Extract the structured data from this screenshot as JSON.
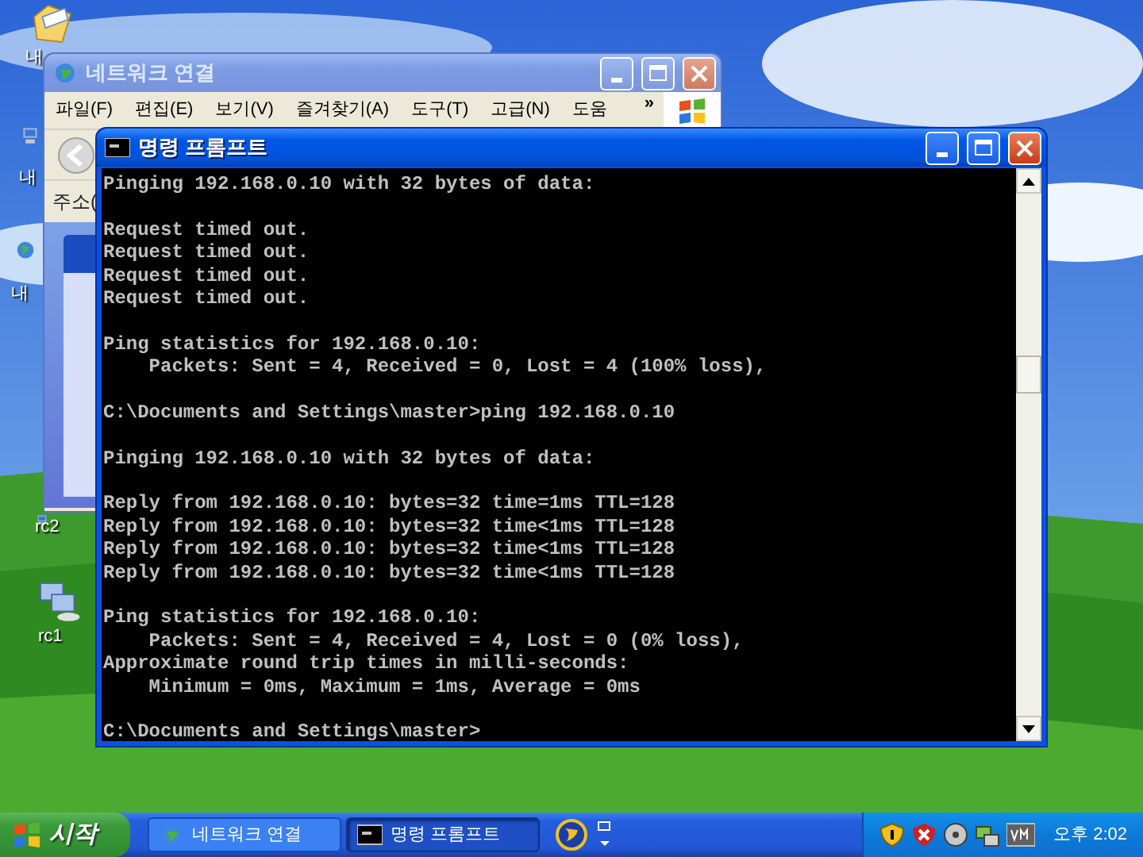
{
  "desktop_icons": [
    {
      "label": "내",
      "kind": "folder"
    },
    {
      "label": "내",
      "kind": "computer"
    },
    {
      "label": "내",
      "kind": "globe"
    },
    {
      "label": "rc2",
      "kind": "computer"
    },
    {
      "label": "rc1",
      "kind": "network"
    }
  ],
  "explorer_window": {
    "title": "네트워크 연결",
    "active": false,
    "menu": [
      "파일(F)",
      "편집(E)",
      "보기(V)",
      "즐겨찾기(A)",
      "도구(T)",
      "고급(N)",
      "도움"
    ],
    "menu_more": "»",
    "address_label": "주소("
  },
  "cmd_window": {
    "title": "명령 프롬프트",
    "active": true,
    "blocks": [
      [
        "Pinging 192.168.0.10 with 32 bytes of data:"
      ],
      [
        "Request timed out.",
        "Request timed out.",
        "Request timed out.",
        "Request timed out."
      ],
      [
        "Ping statistics for 192.168.0.10:",
        "    Packets: Sent = 4, Received = 0, Lost = 4 (100% loss),"
      ],
      [
        "C:\\Documents and Settings\\master>ping 192.168.0.10"
      ],
      [
        "Pinging 192.168.0.10 with 32 bytes of data:"
      ],
      [
        "Reply from 192.168.0.10: bytes=32 time=1ms TTL=128",
        "Reply from 192.168.0.10: bytes=32 time<1ms TTL=128",
        "Reply from 192.168.0.10: bytes=32 time<1ms TTL=128",
        "Reply from 192.168.0.10: bytes=32 time<1ms TTL=128"
      ],
      [
        "Ping statistics for 192.168.0.10:",
        "    Packets: Sent = 4, Received = 4, Lost = 0 (0% loss),",
        "Approximate round trip times in milli-seconds:",
        "    Minimum = 0ms, Maximum = 1ms, Average = 0ms"
      ],
      [
        "C:\\Documents and Settings\\master>"
      ]
    ]
  },
  "taskbar": {
    "start": "시작",
    "tasks": [
      {
        "label": "네트워크 연결",
        "kind": "explorer",
        "selected": false
      },
      {
        "label": "명령 프롬프트",
        "kind": "cmd",
        "selected": true
      }
    ],
    "clock": "오후 2:02"
  }
}
